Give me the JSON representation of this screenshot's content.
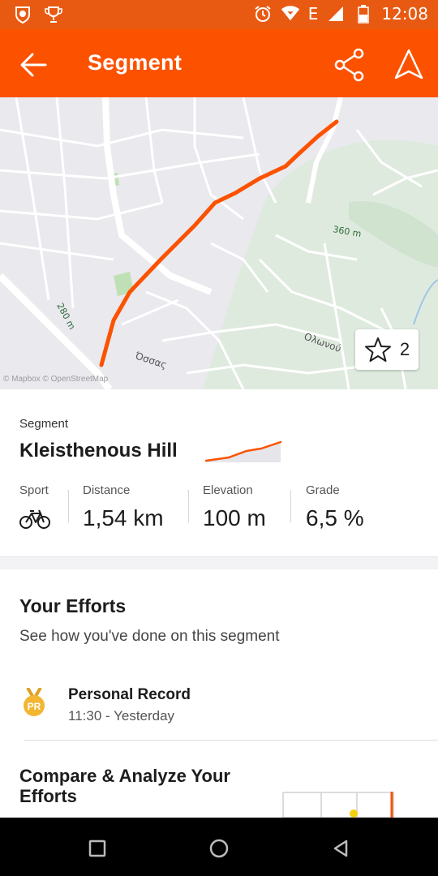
{
  "status_bar": {
    "time": "12:08",
    "network_label": "E",
    "left_icons": [
      "lion-badge-icon",
      "trophy-icon"
    ],
    "right_icons": [
      "alarm-icon",
      "wifi-icon",
      "signal-icon",
      "battery-icon"
    ]
  },
  "app_bar": {
    "title": "Segment",
    "back_icon": "arrow-left-icon",
    "share_icon": "share-icon",
    "navigate_icon": "navigation-arrow-icon"
  },
  "map": {
    "labels": {
      "contour_280": "280 m",
      "contour_360": "360 m",
      "street_olonou": "Ολωνού",
      "street_ossas": "Όσσας"
    },
    "attribution": "© Mapbox © OpenStreetMap",
    "star_count": "2"
  },
  "segment": {
    "label": "Segment",
    "name": "Kleisthenous Hill",
    "stats": [
      {
        "key": "Sport",
        "value": ""
      },
      {
        "key": "Distance",
        "value": "1,54 km"
      },
      {
        "key": "Elevation",
        "value": "100 m"
      },
      {
        "key": "Grade",
        "value": "6,5 %"
      }
    ]
  },
  "efforts": {
    "title": "Your Efforts",
    "subtitle": "See how you've done on this segment",
    "personal_record": {
      "badge": "PR",
      "title": "Personal Record",
      "time": "11:30 - Yesterday"
    },
    "compare_title": "Compare & Analyze Your Efforts"
  },
  "colors": {
    "accent": "#fc5200",
    "status_bar": "#e85a12",
    "route": "#fc5200",
    "pr_gold": "#f2b632"
  }
}
